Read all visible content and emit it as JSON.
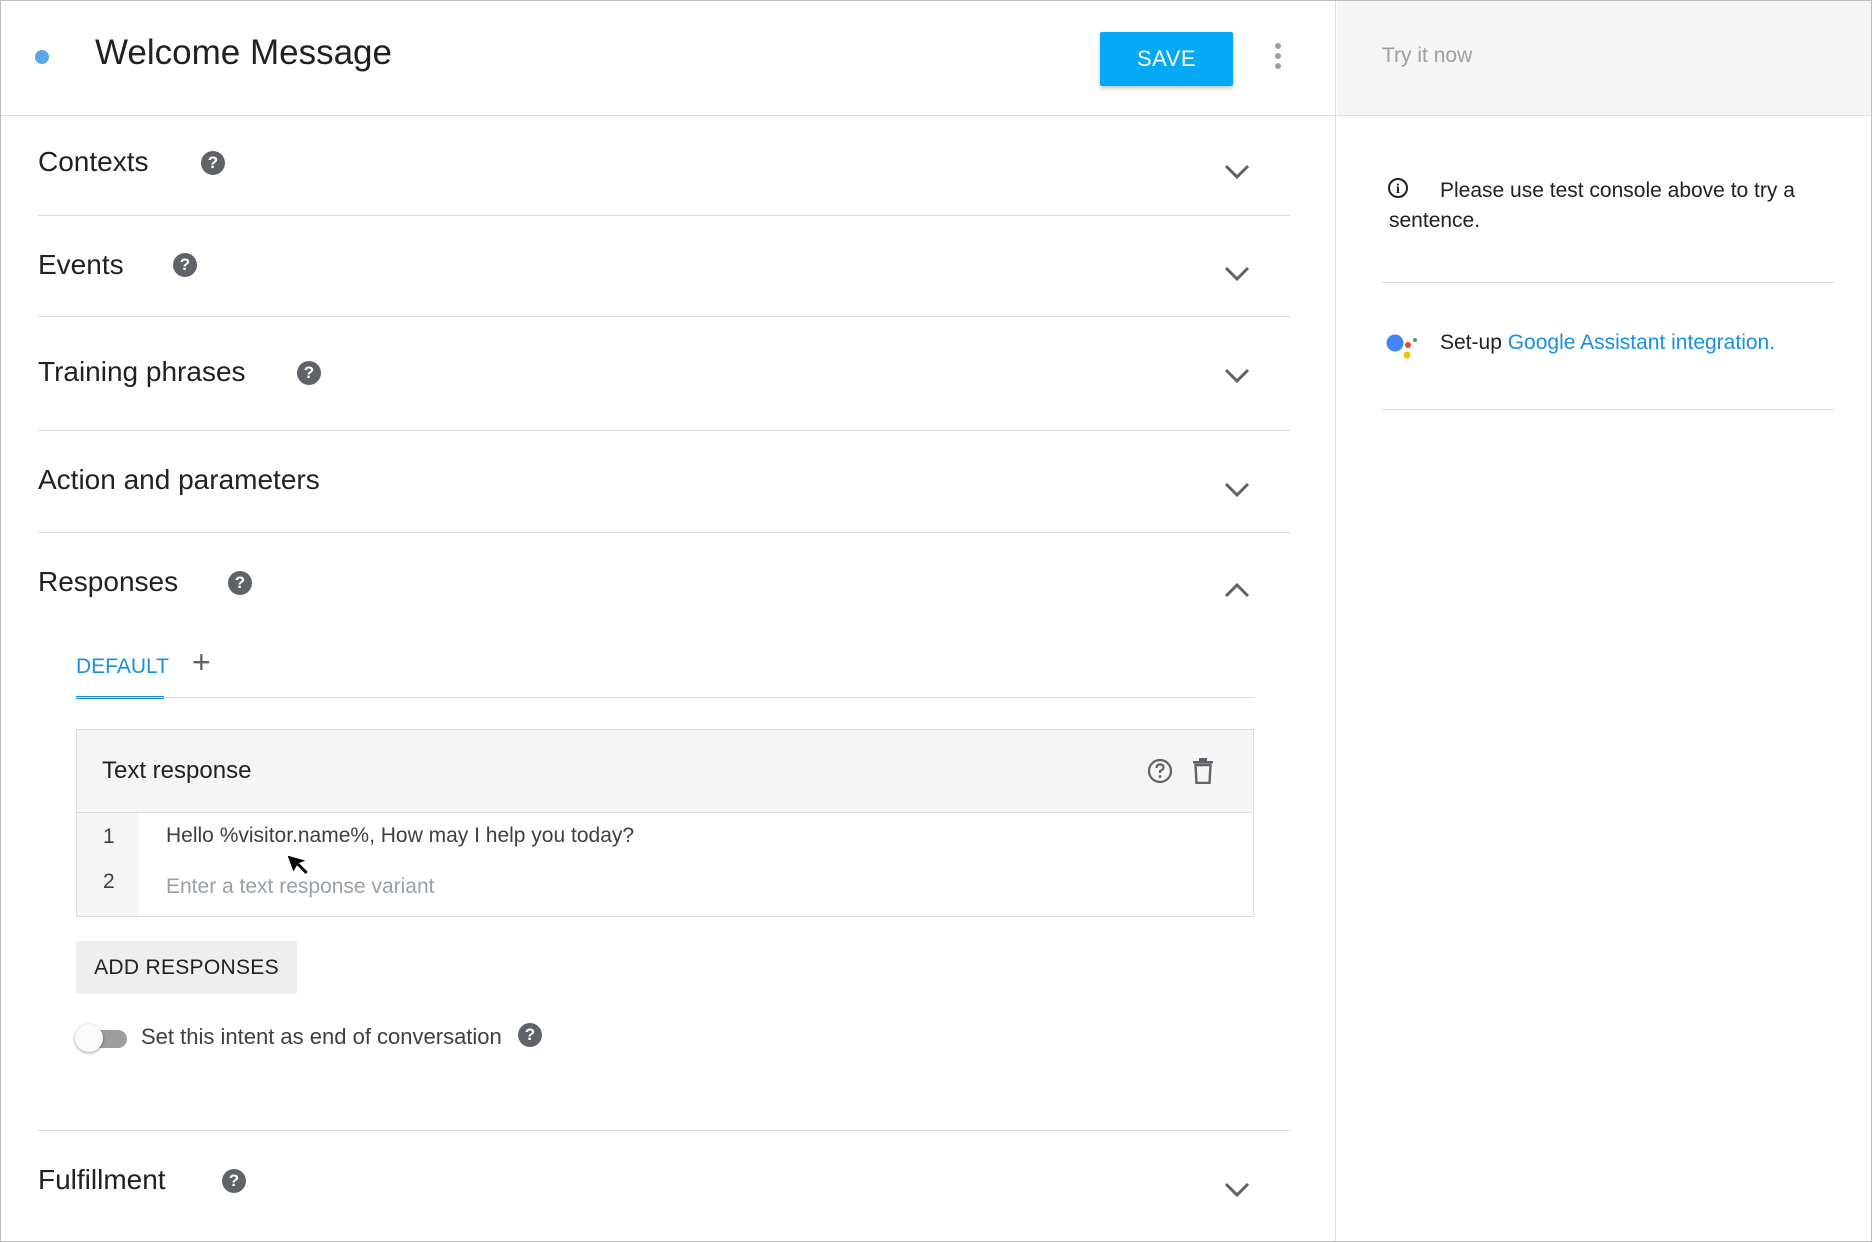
{
  "intent": {
    "name": "Welcome Message",
    "status_color": "#5aa7ec"
  },
  "toolbar": {
    "save_label": "SAVE",
    "more_icon": "more-vert-icon"
  },
  "sections": {
    "contexts": {
      "title": "Contexts",
      "has_help": true,
      "expanded": false
    },
    "events": {
      "title": "Events",
      "has_help": true,
      "expanded": false
    },
    "training_phrases": {
      "title": "Training phrases",
      "has_help": true,
      "expanded": false
    },
    "action_parameters": {
      "title": "Action and parameters",
      "has_help": false,
      "expanded": false
    },
    "responses": {
      "title": "Responses",
      "has_help": true,
      "expanded": true
    },
    "fulfillment": {
      "title": "Fulfillment",
      "has_help": true,
      "expanded": false
    }
  },
  "responses": {
    "tabs": [
      {
        "label": "DEFAULT",
        "active": true
      }
    ],
    "add_tab_label": "+",
    "card": {
      "title": "Text response",
      "lines": [
        {
          "number": "1",
          "text": "Hello %visitor.name%,  How may I help you today?"
        },
        {
          "number": "2",
          "placeholder": "Enter a text response variant"
        }
      ]
    },
    "add_responses_label": "ADD RESPONSES",
    "end_conversation": {
      "label": "Set this intent as end of conversation",
      "enabled": false
    }
  },
  "side": {
    "try_placeholder": "Try it now",
    "info_text": "Please use test console above to try a sentence.",
    "assistant": {
      "prefix": "Set-up ",
      "link": "Google Assistant integration."
    }
  },
  "colors": {
    "accent": "#03a9f4",
    "link": "#1a8fdd",
    "help_icon": "#5f6368"
  }
}
